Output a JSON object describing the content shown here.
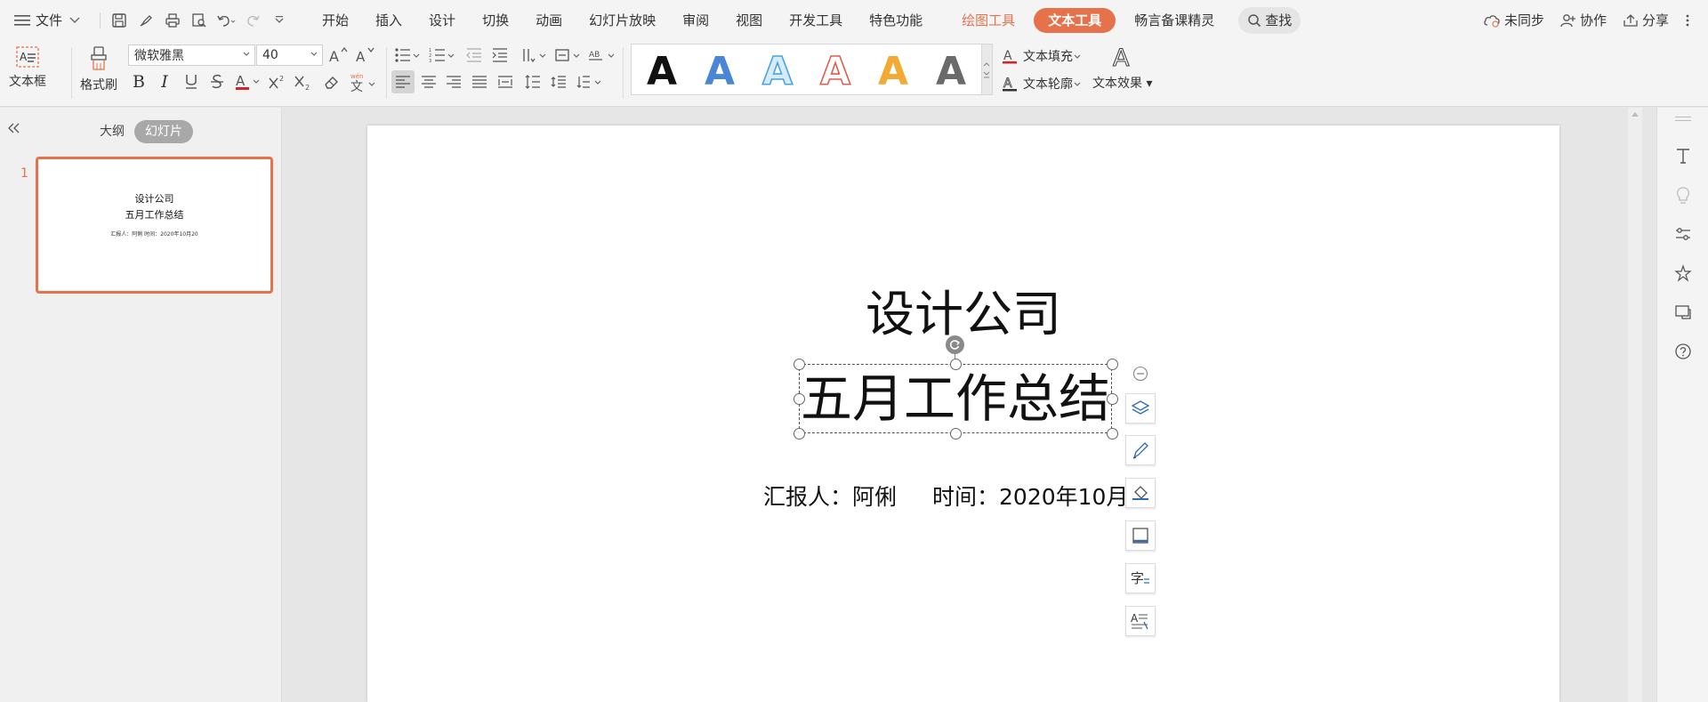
{
  "menubar": {
    "file_label": "文件",
    "tabs": [
      {
        "label": "开始"
      },
      {
        "label": "插入"
      },
      {
        "label": "设计"
      },
      {
        "label": "切换"
      },
      {
        "label": "动画"
      },
      {
        "label": "幻灯片放映"
      },
      {
        "label": "审阅"
      },
      {
        "label": "视图"
      },
      {
        "label": "开发工具"
      },
      {
        "label": "特色功能"
      }
    ],
    "drawing_tools": "绘图工具",
    "text_tools": "文本工具",
    "lesson_genie": "畅言备课精灵",
    "search_label": "查找",
    "sync_label": "未同步",
    "collab_label": "协作",
    "share_label": "分享"
  },
  "ribbon": {
    "textbox_label": "文本框",
    "format_painter_label": "格式刷",
    "font_name": "微软雅黑",
    "font_size": "40",
    "text_fill_label": "文本填充",
    "text_outline_label": "文本轮廓",
    "text_effect_label": "文本效果",
    "style_gallery": [
      {
        "name": "black-solid",
        "fill": "#111111",
        "stroke": "none"
      },
      {
        "name": "blue-solid",
        "fill": "#4a86d8",
        "stroke": "none"
      },
      {
        "name": "light-blue-outline",
        "fill": "#d7ecfb",
        "stroke": "#4aa3e0"
      },
      {
        "name": "red-outline",
        "fill": "#ffffff",
        "stroke": "#e05d50"
      },
      {
        "name": "orange-solid",
        "fill": "#f2aa34",
        "stroke": "none"
      },
      {
        "name": "gray-gradient",
        "fill": "#6a6a6a",
        "stroke": "none"
      }
    ]
  },
  "left_panel": {
    "outline_tab": "大纲",
    "slides_tab": "幻灯片",
    "slide_number": "1"
  },
  "slide": {
    "title": "设计公司",
    "subtitle": "五月工作总结",
    "reporter": "汇报人：阿俐",
    "time": "时间：2020年10月20",
    "thumb_info": "汇报人：阿俐      时间：2020年10月20"
  },
  "colors": {
    "accent": "#e6724b",
    "ribbon_bg": "#f4f4f4",
    "canvas_bg": "#e6e6e6"
  }
}
